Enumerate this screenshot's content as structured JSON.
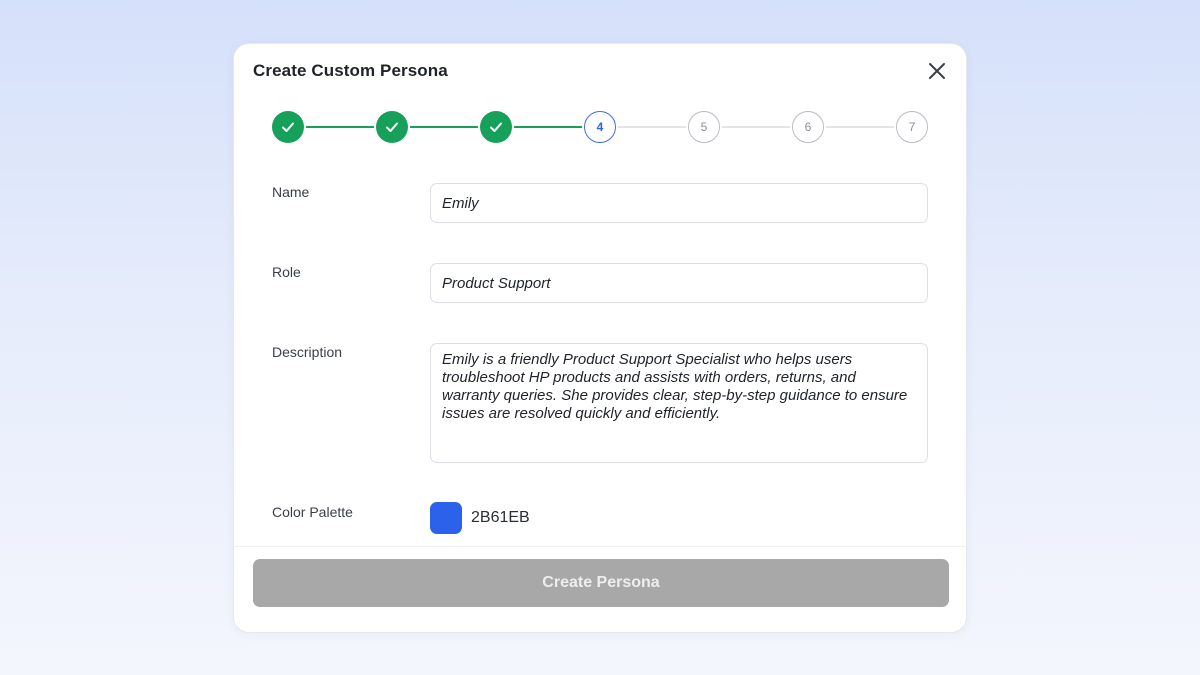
{
  "dialog": {
    "title": "Create Custom Persona",
    "close_icon": "close-icon"
  },
  "stepper": {
    "current_step": 4,
    "total_steps": 7,
    "completed_color": "#16A05A",
    "active_color": "#2B61EB",
    "steps": [
      {
        "status": "done",
        "label": ""
      },
      {
        "status": "done",
        "label": ""
      },
      {
        "status": "done",
        "label": ""
      },
      {
        "status": "active",
        "label": "4"
      },
      {
        "status": "todo",
        "label": "5"
      },
      {
        "status": "todo",
        "label": "6"
      },
      {
        "status": "todo",
        "label": "7"
      }
    ]
  },
  "form": {
    "name": {
      "label": "Name",
      "value": "Emily"
    },
    "role": {
      "label": "Role",
      "value": "Product Support"
    },
    "description": {
      "label": "Description",
      "value": "Emily is a friendly Product Support Specialist who helps users troubleshoot HP products and assists with orders, returns, and warranty queries. She provides clear, step-by-step guidance to ensure issues are resolved quickly and efficiently."
    },
    "color_palette": {
      "label": "Color Palette",
      "value": "2B61EB",
      "swatch_color": "#2B61EB"
    }
  },
  "submit": {
    "label": "Create Persona",
    "disabled": true
  }
}
